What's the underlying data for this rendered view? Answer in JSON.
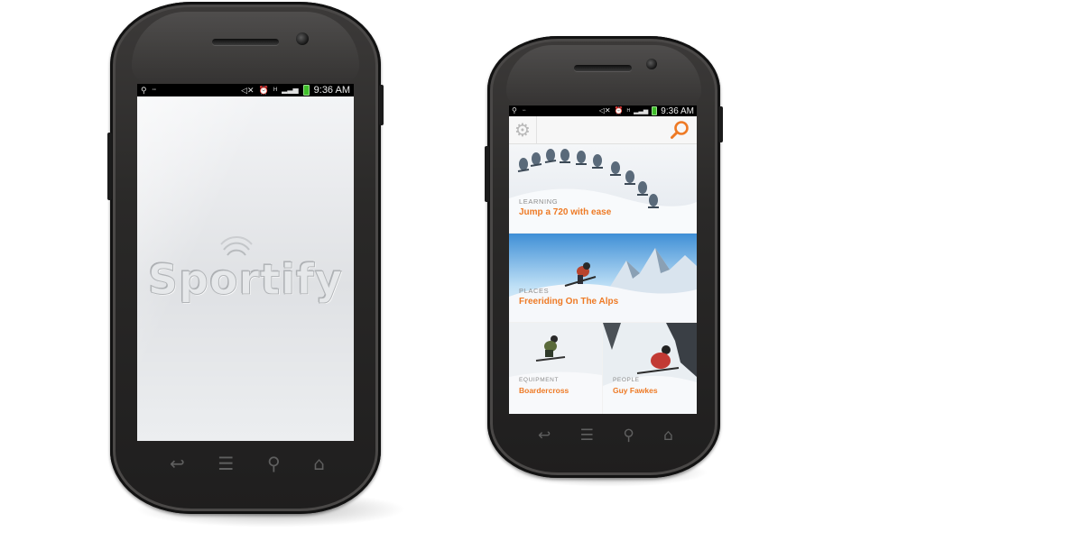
{
  "phone_left": {
    "status_bar": {
      "time": "9:36 AM"
    },
    "splash": {
      "logo_text": "Sportify"
    }
  },
  "phone_right": {
    "status_bar": {
      "time": "9:36 AM"
    },
    "header": {
      "settings_icon": "gear-icon",
      "search_icon": "search-icon"
    },
    "cards": [
      {
        "category": "LEARNING",
        "title": "Jump a 720 with ease"
      },
      {
        "category": "PLACES",
        "title": "Freeriding On The Alps"
      },
      {
        "category": "EQUIPMENT",
        "title": "Boardercross"
      },
      {
        "category": "PEOPLE",
        "title": "Guy Fawkes"
      }
    ]
  },
  "soft_keys": [
    "back-icon",
    "menu-icon",
    "search-icon",
    "home-icon"
  ],
  "colors": {
    "accent_orange": "#ee7a25",
    "battery_green": "#3fbf2a",
    "phone_body": "#2a2928"
  }
}
